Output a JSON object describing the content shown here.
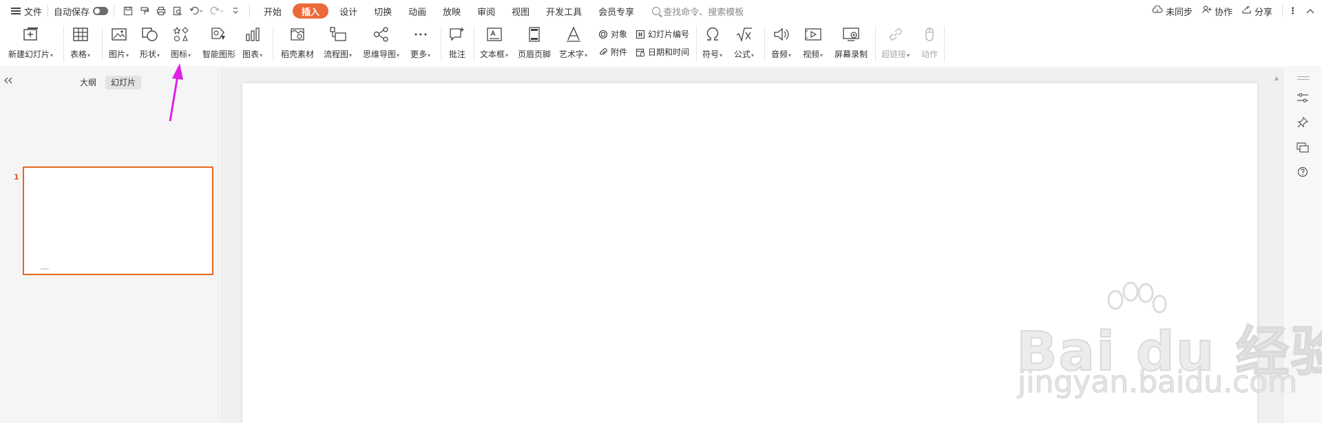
{
  "menubar": {
    "file": "文件",
    "autosave": "自动保存",
    "tabs": [
      "开始",
      "插入",
      "设计",
      "切换",
      "动画",
      "放映",
      "审阅",
      "视图",
      "开发工具",
      "会员专享"
    ],
    "active_tab": "插入",
    "search_placeholder": "查找命令、搜索模板",
    "sync": "未同步",
    "collab": "协作",
    "share": "分享"
  },
  "ribbon": {
    "new_slide": "新建幻灯片",
    "table": "表格",
    "picture": "图片",
    "shape": "形状",
    "icon": "图标",
    "smart_shape": "智能图形",
    "chart": "图表",
    "material": "稻壳素材",
    "flowchart": "流程图",
    "mindmap": "思维导图",
    "more": "更多",
    "comment": "批注",
    "textbox": "文本框",
    "header_footer": "页眉页脚",
    "wordart": "艺术字",
    "object": "对象",
    "attachment": "附件",
    "slide_number": "幻灯片编号",
    "datetime": "日期和时间",
    "symbol": "符号",
    "formula": "公式",
    "audio": "音频",
    "video": "视频",
    "screen_record": "屏幕录制",
    "hyperlink": "超链接",
    "action": "动作"
  },
  "leftpanel": {
    "tab_outline": "大纲",
    "tab_slides": "幻灯片",
    "slide_number": "1"
  },
  "watermark": {
    "brand": "Bai du 经验",
    "url": "jingyan.baidu.com"
  },
  "colors": {
    "accent": "#eb6a3a",
    "selection": "#e2671e",
    "annotation_arrow": "#e020e8"
  }
}
